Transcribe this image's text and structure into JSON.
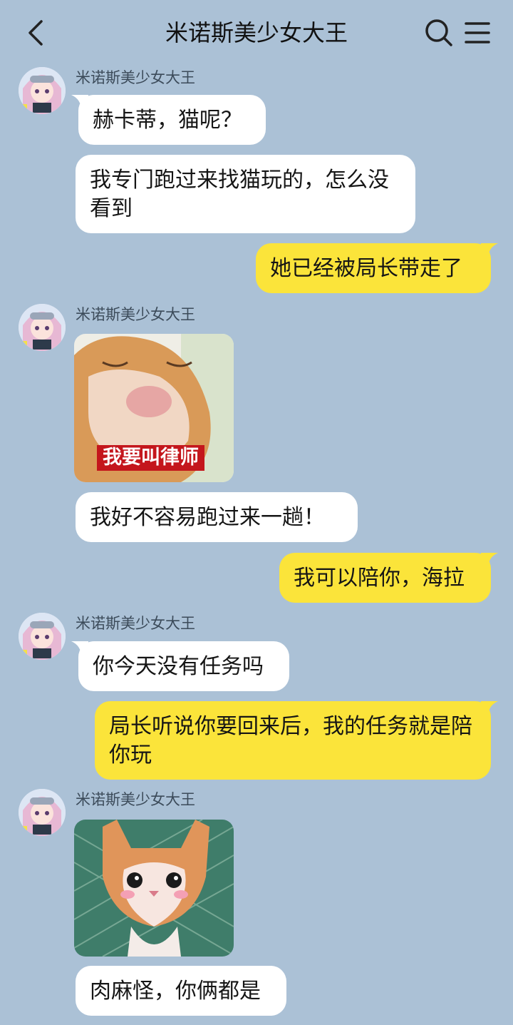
{
  "header": {
    "title": "米诺斯美少女大王",
    "back_icon": "chevron-left-icon",
    "search_icon": "search-icon",
    "menu_icon": "menu-icon"
  },
  "colors": {
    "background": "#abc1d6",
    "incoming_bubble": "#ffffff",
    "outgoing_bubble": "#fbe43a",
    "sticker_caption_bg": "#c4161c"
  },
  "messages": [
    {
      "direction": "in",
      "sender": "米诺斯美少女大王",
      "text": "赫卡蒂，猫呢？"
    },
    {
      "direction": "in",
      "text": "我专门跑过来找猫玩的，怎么没看到"
    },
    {
      "direction": "out",
      "text": "她已经被局长带走了"
    },
    {
      "direction": "in",
      "sender": "米诺斯美少女大王",
      "sticker": "crying-kitten-sticker",
      "caption": "我要叫律师"
    },
    {
      "direction": "in",
      "text": "我好不容易跑过来一趟！"
    },
    {
      "direction": "out",
      "text": "我可以陪你，海拉"
    },
    {
      "direction": "in",
      "sender": "米诺斯美少女大王",
      "text": "你今天没有任务吗"
    },
    {
      "direction": "out",
      "text": "局长听说你要回来后，我的任务就是陪你玩"
    },
    {
      "direction": "in",
      "sender": "米诺斯美少女大王",
      "sticker": "blushing-kitten-sticker"
    },
    {
      "direction": "in",
      "text": "肉麻怪，你俩都是"
    }
  ]
}
